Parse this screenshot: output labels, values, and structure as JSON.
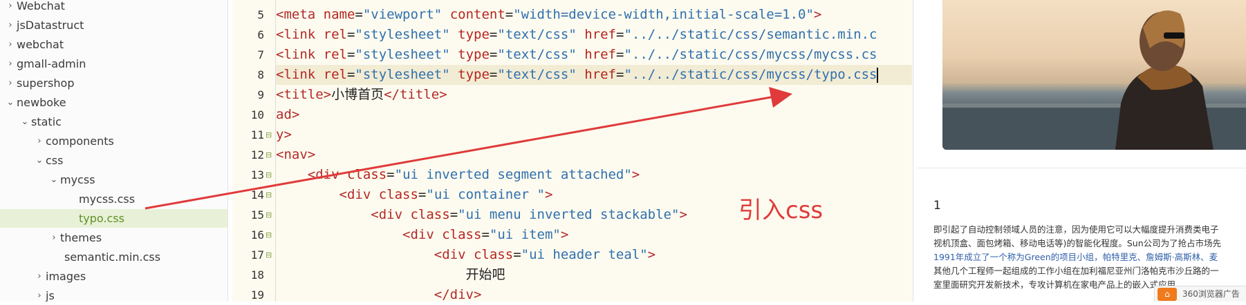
{
  "tree": {
    "items": [
      {
        "label": "Webchat",
        "chevron": "›",
        "indent": 0
      },
      {
        "label": "jsDatastruct",
        "chevron": "›",
        "indent": 0
      },
      {
        "label": "webchat",
        "chevron": "›",
        "indent": 0
      },
      {
        "label": "gmall-admin",
        "chevron": "›",
        "indent": 0
      },
      {
        "label": "supershop",
        "chevron": "›",
        "indent": 0
      },
      {
        "label": "newboke",
        "chevron": "⌄",
        "indent": 0
      },
      {
        "label": "static",
        "chevron": "⌄",
        "indent": 1
      },
      {
        "label": "components",
        "chevron": "›",
        "indent": 2
      },
      {
        "label": "css",
        "chevron": "⌄",
        "indent": 2
      },
      {
        "label": "mycss",
        "chevron": "⌄",
        "indent": 3
      },
      {
        "label": "mycss.css",
        "chevron": "",
        "indent": 4
      },
      {
        "label": "typo.css",
        "chevron": "",
        "indent": 4,
        "selected": true
      },
      {
        "label": "themes",
        "chevron": "›",
        "indent": 3
      },
      {
        "label": "semantic.min.css",
        "chevron": "",
        "indent": 3
      },
      {
        "label": "images",
        "chevron": "›",
        "indent": 2
      },
      {
        "label": "js",
        "chevron": "›",
        "indent": 2
      }
    ]
  },
  "editor": {
    "lines": [
      {
        "num": "5",
        "fold": "",
        "hl": false,
        "tokens": [
          [
            "t",
            "<meta "
          ],
          [
            "a",
            "name"
          ],
          [
            "p",
            "="
          ],
          [
            "s",
            "\"viewport\""
          ],
          [
            "p",
            " "
          ],
          [
            "a",
            "content"
          ],
          [
            "p",
            "="
          ],
          [
            "s",
            "\"width=device-width,initial-scale=1.0\""
          ],
          [
            "t",
            ">"
          ]
        ]
      },
      {
        "num": "6",
        "fold": "",
        "hl": false,
        "tokens": [
          [
            "t",
            "<link "
          ],
          [
            "a",
            "rel"
          ],
          [
            "p",
            "="
          ],
          [
            "s",
            "\"stylesheet\""
          ],
          [
            "p",
            " "
          ],
          [
            "a",
            "type"
          ],
          [
            "p",
            "="
          ],
          [
            "s",
            "\"text/css\""
          ],
          [
            "p",
            " "
          ],
          [
            "a",
            "href"
          ],
          [
            "p",
            "="
          ],
          [
            "s",
            "\"../../static/css/semantic.min.c"
          ]
        ]
      },
      {
        "num": "7",
        "fold": "",
        "hl": false,
        "tokens": [
          [
            "t",
            "<link "
          ],
          [
            "a",
            "rel"
          ],
          [
            "p",
            "="
          ],
          [
            "s",
            "\"stylesheet\""
          ],
          [
            "p",
            " "
          ],
          [
            "a",
            "type"
          ],
          [
            "p",
            "="
          ],
          [
            "s",
            "\"text/css\""
          ],
          [
            "p",
            " "
          ],
          [
            "a",
            "href"
          ],
          [
            "p",
            "="
          ],
          [
            "s",
            "\"../../static/css/mycss/mycss.cs"
          ]
        ]
      },
      {
        "num": "8",
        "fold": "",
        "hl": true,
        "tokens": [
          [
            "t",
            "<link "
          ],
          [
            "a",
            "rel"
          ],
          [
            "p",
            "="
          ],
          [
            "s",
            "\"stylesheet\""
          ],
          [
            "p",
            " "
          ],
          [
            "a",
            "type"
          ],
          [
            "p",
            "="
          ],
          [
            "s",
            "\"text/css\""
          ],
          [
            "p",
            " "
          ],
          [
            "a",
            "href"
          ],
          [
            "p",
            "="
          ],
          [
            "s",
            "\"../../static/css/mycss/typo.css"
          ]
        ]
      },
      {
        "num": "9",
        "fold": "",
        "hl": false,
        "tokens": [
          [
            "t",
            "<title>"
          ],
          [
            "p",
            "小博首页"
          ],
          [
            "t",
            "</title>"
          ]
        ]
      },
      {
        "num": "10",
        "fold": "",
        "hl": false,
        "tokens": [
          [
            "t",
            "ad>"
          ]
        ]
      },
      {
        "num": "11",
        "fold": "⊟",
        "hl": false,
        "tokens": [
          [
            "t",
            "y>"
          ]
        ]
      },
      {
        "num": "12",
        "fold": "⊟",
        "hl": false,
        "tokens": [
          [
            "t",
            "<nav>"
          ]
        ]
      },
      {
        "num": "13",
        "fold": "⊟",
        "hl": false,
        "tokens": [
          [
            "p",
            "    "
          ],
          [
            "t",
            "<div "
          ],
          [
            "a",
            "class"
          ],
          [
            "p",
            "="
          ],
          [
            "s",
            "\"ui inverted segment attached\""
          ],
          [
            "t",
            ">"
          ]
        ]
      },
      {
        "num": "14",
        "fold": "⊟",
        "hl": false,
        "tokens": [
          [
            "p",
            "        "
          ],
          [
            "t",
            "<div "
          ],
          [
            "a",
            "class"
          ],
          [
            "p",
            "="
          ],
          [
            "s",
            "\"ui container \""
          ],
          [
            "t",
            ">"
          ]
        ]
      },
      {
        "num": "15",
        "fold": "⊟",
        "hl": false,
        "tokens": [
          [
            "p",
            "            "
          ],
          [
            "t",
            "<div "
          ],
          [
            "a",
            "class"
          ],
          [
            "p",
            "="
          ],
          [
            "s",
            "\"ui menu inverted stackable\""
          ],
          [
            "t",
            ">"
          ]
        ]
      },
      {
        "num": "16",
        "fold": "⊟",
        "hl": false,
        "tokens": [
          [
            "p",
            "                "
          ],
          [
            "t",
            "<div "
          ],
          [
            "a",
            "class"
          ],
          [
            "p",
            "="
          ],
          [
            "s",
            "\"ui item\""
          ],
          [
            "t",
            ">"
          ]
        ]
      },
      {
        "num": "17",
        "fold": "⊟",
        "hl": false,
        "tokens": [
          [
            "p",
            "                    "
          ],
          [
            "t",
            "<div "
          ],
          [
            "a",
            "class"
          ],
          [
            "p",
            "="
          ],
          [
            "s",
            "\"ui header teal\""
          ],
          [
            "t",
            ">"
          ]
        ]
      },
      {
        "num": "18",
        "fold": "",
        "hl": false,
        "tokens": [
          [
            "p",
            "                        开始吧"
          ]
        ]
      },
      {
        "num": "19",
        "fold": "",
        "hl": false,
        "tokens": [
          [
            "p",
            "                    "
          ],
          [
            "t",
            "</div>"
          ]
        ]
      }
    ]
  },
  "annotation": {
    "text": "引入css",
    "color": "#e03a3a"
  },
  "preview": {
    "title": "1",
    "lines": [
      "即引起了自动控制领域人员的注意，因为使用它可以大幅度提升消费类电子",
      "视机顶盒、面包烤箱、移动电话等)的智能化程度。Sun公司为了抢占市场先",
      "1991年成立了一个称为Green的项目小组，帕特里克、詹姆斯·高斯林、麦",
      "其他几个工程师一起组成的工作小组在加利福尼亚州门洛帕克市沙丘路的一",
      "室里面研究开发新技术，专攻计算机在家电产品上的嵌入式应用。"
    ],
    "ad_label": "360浏览器广告",
    "ad_icon": "360-browser-icon"
  },
  "colors": {
    "tag": "#b22a2a",
    "attr": "#b5251f",
    "string": "#2f6fae",
    "selected_tree_bg": "#e8f1d8",
    "arrow": "#e03a3a"
  }
}
